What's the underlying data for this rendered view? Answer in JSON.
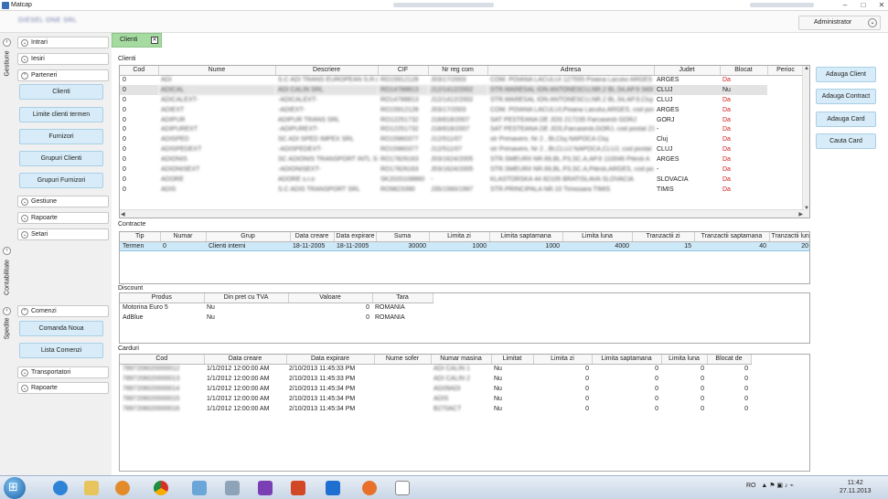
{
  "window": {
    "title": "Matcap",
    "subtitle": "DIESEL ONE SRL",
    "user_button": "Administrator"
  },
  "vertical_tabs": [
    "Gestiune",
    "Contabilitate",
    "Spedite"
  ],
  "sidebar": {
    "gestiune_groups": [
      "Intrari",
      "Iesiri",
      "Parteneri"
    ],
    "parteneri_buttons": [
      "Clienti",
      "Limite clienti termen",
      "Furnizori",
      "Grupuri Clienti",
      "Grupuri Furnizori"
    ],
    "gestiune_more": [
      "Gestiune",
      "Rapoarte",
      "Setari"
    ],
    "spedite_groups": [
      "Comenzi"
    ],
    "comenzi_buttons": [
      "Comanda Noua",
      "Lista Comenzi"
    ],
    "spedite_more": [
      "Transportatori",
      "Rapoarte"
    ]
  },
  "main": {
    "tab_label": "Clienti",
    "tab_close": "✕",
    "clienti": {
      "section": "Clienti",
      "columns": [
        "Cod",
        "Nume",
        "Descriere",
        "CIF",
        "Nr reg com",
        "Adresa",
        "Judet",
        "Blocat",
        "Perioc"
      ],
      "rows": [
        [
          "0",
          "ADI",
          "S.C ADI TRANS EUROPEAN S.R.L",
          "RO15912128",
          "J03/17/2003",
          "COM. POIANA LACULUI 127555 Poiana Lacului ARGES",
          "ARGES",
          "Da"
        ],
        [
          "0",
          "ADICAL",
          "ADI CALIN SRL",
          "RO14788813",
          "J12/1412/2002",
          "STR.MARESAL ION ANTONESCU,NR.2 BL.54,AP.9 3400",
          "CLUJ",
          "Nu"
        ],
        [
          "0",
          "ADICALEXT-",
          "-ADICALEXT-",
          "RO14788813",
          "J12/1412/2002",
          "STR.MARESAL ION ANTONESCU,NR.2 BL.54,AP.9,Cluj-N",
          "CLUJ",
          "Da"
        ],
        [
          "0",
          "ADIEXT",
          "-ADIEXT-",
          "RO15912128",
          "J03/17/2003",
          "COM. POIANA LACULUI,Poiana Lacului,ARGES, cod postal",
          "ARGES",
          "Da"
        ],
        [
          "0",
          "ADIPUR",
          "ADIPUR TRANS SRL",
          "RO12251732",
          "J18/818/2007",
          "SAT PESTEANA DE JOS 217235 Farcasesti GORJ",
          "GORJ",
          "Da"
        ],
        [
          "0",
          "ADIPUREXT",
          "-ADIPUREXT-",
          "RO12251732",
          "J18/818/2007",
          "SAT PESTEANA DE JOS,Farcasesti,GORJ, cod postal 217",
          "-",
          "Da"
        ],
        [
          "0",
          "ADISPED",
          "SC ADI SPED IMPEX SRL",
          "RO15960377",
          "J12/511/07",
          "str Primaverii, Nr 2 , Bl,Cluj NAPOCA Cluj",
          "Cluj",
          "Da"
        ],
        [
          "0",
          "ADISPEDEXT",
          "-ADISPEDEXT-",
          "RO15960377",
          "J12/511/07",
          "str Primaverii, Nr 2 , Bl,CLUJ NAPOCA,CLUJ, cod postal",
          "CLUJ",
          "Da"
        ],
        [
          "0",
          "ADIONIS",
          "SC ADIONIS TRANSPORT INTL SRL",
          "RO17826163",
          "J03/1624/2005",
          "STR.SMEURII NR.69,BL.P3,SC.A,AP.6 110046 Pitesti A",
          "ARGES",
          "Da"
        ],
        [
          "0",
          "ADIONISEXT",
          "-ADIONISEXT-",
          "RO17826163",
          "J03/1624/2005",
          "STR.SMEURII NR.69,BL.P3,SC.A,Pitesti,ARGES, cod post",
          "-",
          "Da"
        ],
        [
          "0",
          "ADORE",
          "ADORE s.r.o",
          "SK2020108860",
          "-",
          "KLASTORSKA 44 82105 BRATISLAVA SLOVACIA",
          "SLOVACIA",
          "Da"
        ],
        [
          "0",
          "ADIS",
          "S.C ADIS TRANSPORT SRL",
          "RO9823390",
          "J35/1560/1997",
          "STR.PRINCIPALA NR.10 Timisoara TIMIS",
          "TIMIS",
          "Da"
        ]
      ]
    },
    "contracte": {
      "section": "Contracte",
      "columns": [
        "Tip",
        "Numar",
        "Grup",
        "Data creare",
        "Data expirare",
        "Suma",
        "Limita zi",
        "Limita saptamana",
        "Limita luna",
        "Tranzactii zi",
        "Tranzactii saptamana",
        "Tranzactii luna"
      ],
      "rows": [
        [
          "Termen",
          "0",
          "Clienti interni",
          "18-11-2005",
          "18-11-2005",
          "30000",
          "1000",
          "1000",
          "4000",
          "15",
          "40",
          "20"
        ]
      ]
    },
    "discount": {
      "section": "Discount",
      "columns": [
        "Produs",
        "Din pret cu TVA",
        "Valoare",
        "Tara"
      ],
      "rows": [
        [
          "Motorina Euro 5",
          "Nu",
          "0",
          "ROMANIA"
        ],
        [
          "AdBlue",
          "Nu",
          "0",
          "ROMANIA"
        ]
      ]
    },
    "carduri": {
      "section": "Carduri",
      "columns": [
        "Cod",
        "Data creare",
        "Data expirare",
        "Nume sofer",
        "Numar masina",
        "Limitat",
        "Limita zi",
        "Limita saptamana",
        "Limita luna",
        "Blocat de"
      ],
      "rows": [
        [
          "7897206020000012",
          "1/1/2012 12:00:00 AM",
          "2/10/2013 11:45:33 PM",
          "",
          "ADI CALIN 1",
          "Nu",
          "0",
          "0",
          "0",
          "0"
        ],
        [
          "7897206020000013",
          "1/1/2012 12:00:00 AM",
          "2/10/2013 11:45:33 PM",
          "",
          "ADI CALIN 2",
          "Nu",
          "0",
          "0",
          "0",
          "0"
        ],
        [
          "7897206020000014",
          "1/1/2012 12:00:00 AM",
          "2/10/2013 11:45:34 PM",
          "",
          "AG09ADI",
          "Nu",
          "0",
          "0",
          "0",
          "0"
        ],
        [
          "7897206020000015",
          "1/1/2012 12:00:00 AM",
          "2/10/2013 11:45:34 PM",
          "",
          "ADIS",
          "Nu",
          "0",
          "0",
          "0",
          "0"
        ],
        [
          "7897206020000016",
          "1/1/2012 12:00:00 AM",
          "2/10/2013 11:45:34 PM",
          "",
          "B270ACT",
          "Nu",
          "0",
          "0",
          "0",
          "0"
        ]
      ]
    }
  },
  "actions": [
    "Adauga Client",
    "Adauga Contract",
    "Adauga Card",
    "Cauta Card"
  ],
  "taskbar": {
    "language": "RO",
    "time": "11:42",
    "date": "27.11.2013"
  },
  "colors": {
    "tab_active": "#a5dba0",
    "button_bg": "#d7ecf8",
    "blocked_text": "#d21b1b",
    "selected_row": "#cde8f7"
  }
}
